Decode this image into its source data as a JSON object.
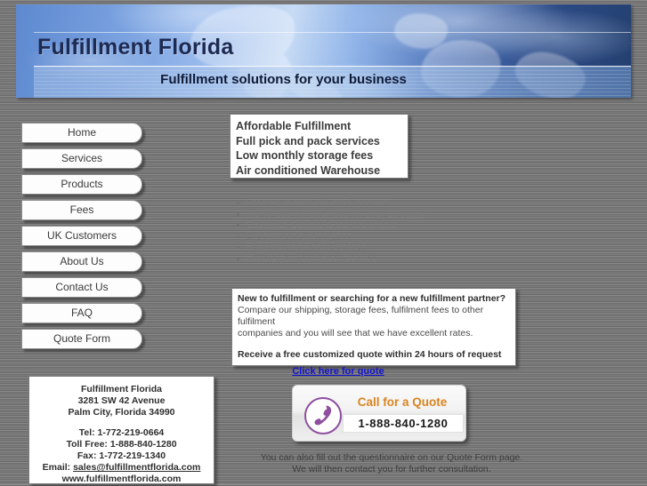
{
  "header": {
    "title": "Fulfillment Florida",
    "tagline": "Fulfillment solutions for your business"
  },
  "sidebar": {
    "items": [
      {
        "label": "Home"
      },
      {
        "label": "Services"
      },
      {
        "label": "Products"
      },
      {
        "label": "Fees"
      },
      {
        "label": "UK Customers"
      },
      {
        "label": "About Us"
      },
      {
        "label": "Contact Us"
      },
      {
        "label": "FAQ"
      },
      {
        "label": "Quote Form"
      }
    ]
  },
  "highlights": [
    "Affordable Fulfillment",
    "Full pick and pack services",
    "Low monthly storage fees",
    "Air conditioned Warehouse"
  ],
  "features": [
    "Located in new industrial complex",
    "We've been in business for over 10 years",
    "Customer Service is our top priority",
    "E-Commerce Integration",
    "Full Pick and Pack Services",
    "Handle your customer Service"
  ],
  "quote_box": {
    "heading": "New to fulfillment or searching for a new fulfillment partner?",
    "body_line1": "Compare our shipping, storage fees, fulfilment fees to other fulfilment",
    "body_line2": "companies and you will see that we have excellent rates.",
    "subheading": "Receive a free customized quote within 24 hours of request",
    "link_label": "Click here for quote",
    "link_color": "#1414d2"
  },
  "contact": {
    "company": "Fulfillment Florida",
    "address1": "3281 SW 42 Avenue",
    "address2": "Palm City, Florida 34990",
    "tel": "Tel: 1-772-219-0664",
    "toll_free": "Toll Free: 1-888-840-1280",
    "fax": "Fax: 1-772-219-1340",
    "email_label": "Email:",
    "email": "sales@fulfillmentflorida.com",
    "website": "www.fulfillmentflorida.com"
  },
  "call_banner": {
    "icon": "phone-icon",
    "text": "Call for a Quote",
    "number": "1-888-840-1280",
    "text_color": "#d98521",
    "icon_color": "#8e4f9e"
  },
  "footer": {
    "line1": "You can also fill out the questionnaire on our Quote Form page.",
    "line2": "We will then contact you for further consultation."
  }
}
